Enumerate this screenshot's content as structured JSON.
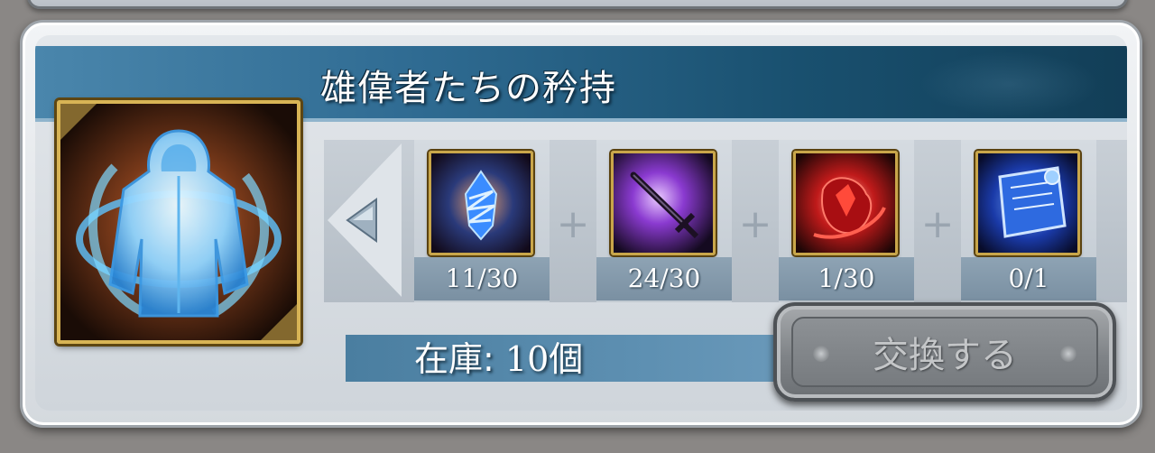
{
  "item": {
    "title": "雄偉者たちの矜持",
    "icon": "blue-hooded-robe-icon"
  },
  "materials": [
    {
      "icon": "blue-crystal-icon",
      "count": "11/30"
    },
    {
      "icon": "dark-sword-icon",
      "count": "24/30"
    },
    {
      "icon": "red-flame-gem-icon",
      "count": "1/30"
    },
    {
      "icon": "blue-scroll-icon",
      "count": "0/1"
    }
  ],
  "stock": {
    "label": "在庫:",
    "value": "10個"
  },
  "actions": {
    "exchange_label": "交換する"
  },
  "colors": {
    "title_bar": "#2f6b92",
    "gold_frame": "#c9a64a",
    "count_bar": "#8ea3b4",
    "button_disabled": "#7f8387"
  }
}
